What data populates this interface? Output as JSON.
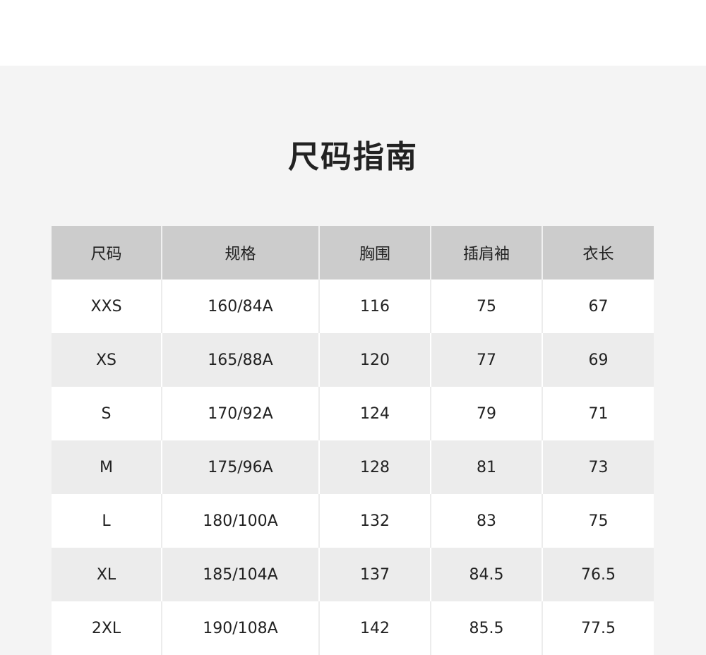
{
  "title": "尺码指南",
  "table": {
    "headers": [
      "尺码",
      "规格",
      "胸围",
      "插肩袖",
      "衣长"
    ],
    "rows": [
      [
        "XXS",
        "160/84A",
        "116",
        "75",
        "67"
      ],
      [
        "XS",
        "165/88A",
        "120",
        "77",
        "69"
      ],
      [
        "S",
        "170/92A",
        "124",
        "79",
        "71"
      ],
      [
        "M",
        "175/96A",
        "128",
        "81",
        "73"
      ],
      [
        "L",
        "180/100A",
        "132",
        "83",
        "75"
      ],
      [
        "XL",
        "185/104A",
        "137",
        "84.5",
        "76.5"
      ],
      [
        "2XL",
        "190/108A",
        "142",
        "85.5",
        "77.5"
      ]
    ]
  },
  "colors": {
    "panel_background": "#f4f4f4",
    "header_background": "#cccccc",
    "row_alt_background": "#ececec",
    "text": "#222222"
  }
}
